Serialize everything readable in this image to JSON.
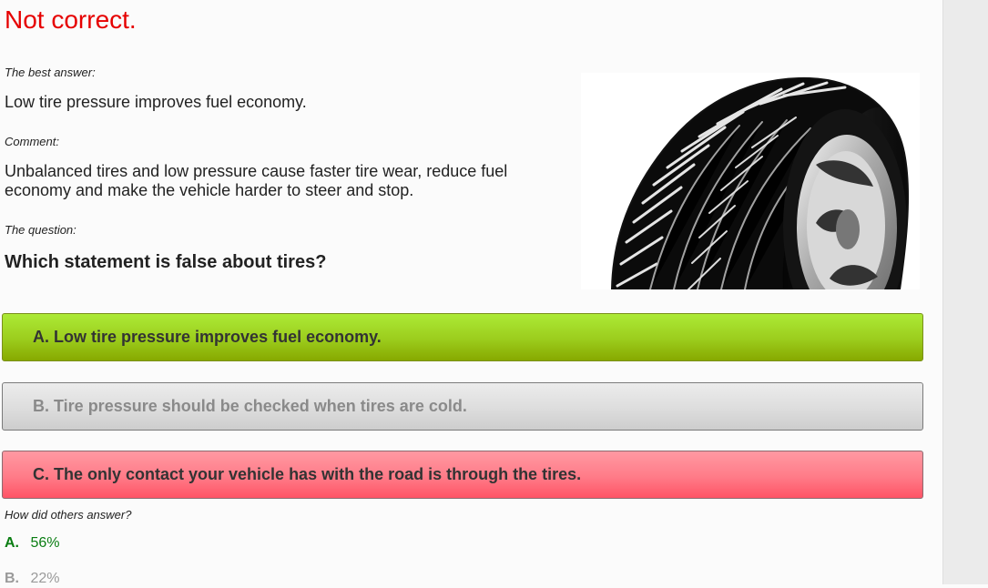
{
  "result": {
    "title": "Not correct.",
    "title_color": "#e60000"
  },
  "best_answer": {
    "label": "The best answer:",
    "text": "Low tire pressure improves fuel economy."
  },
  "comment": {
    "label": "Comment:",
    "text": "Unbalanced tires and low pressure cause faster tire wear, reduce fuel economy and make the vehicle harder to steer and stop."
  },
  "question": {
    "label": "The question:",
    "text": "Which statement is false about tires?"
  },
  "image": {
    "subject": "tire-photo"
  },
  "answers": [
    {
      "text": "A.  Low tire pressure improves fuel economy.",
      "state": "best",
      "color": "#9ccd1d"
    },
    {
      "text": "B.  Tire pressure should be checked when tires are cold.",
      "state": "neutral",
      "color": "#dddddd"
    },
    {
      "text": "C.  The only contact your vehicle has with the road is through the tires.",
      "state": "selected-incorrect",
      "color": "#ff7b88"
    }
  ],
  "stats": {
    "label": "How did others answer?",
    "rows": [
      {
        "letter": "A.",
        "percent": "56%",
        "color": "#0a7d12"
      },
      {
        "letter": "B.",
        "percent": "22%",
        "color": "#9a9a9a"
      }
    ]
  }
}
